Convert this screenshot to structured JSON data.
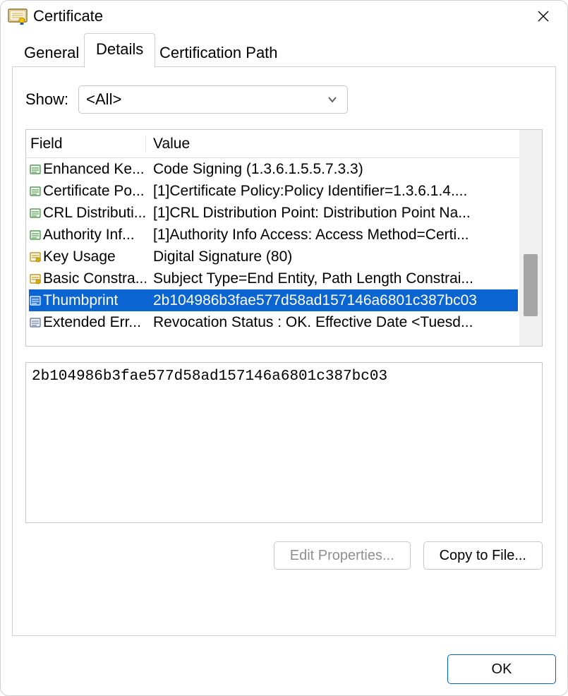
{
  "window": {
    "title": "Certificate"
  },
  "tabs": [
    {
      "label": "General",
      "active": false
    },
    {
      "label": "Details",
      "active": true
    },
    {
      "label": "Certification Path",
      "active": false
    }
  ],
  "show": {
    "label": "Show:",
    "value": "<All>"
  },
  "list": {
    "headers": {
      "field": "Field",
      "value": "Value"
    },
    "rows": [
      {
        "icon": "ext",
        "field": "Enhanced Ke...",
        "value": "Code Signing (1.3.6.1.5.5.7.3.3)",
        "selected": false
      },
      {
        "icon": "ext",
        "field": "Certificate Po...",
        "value": "[1]Certificate Policy:Policy Identifier=1.3.6.1.4....",
        "selected": false
      },
      {
        "icon": "ext",
        "field": "CRL Distributi...",
        "value": "[1]CRL Distribution Point: Distribution Point Na...",
        "selected": false
      },
      {
        "icon": "ext",
        "field": "Authority Inf...",
        "value": "[1]Authority Info Access: Access Method=Certi...",
        "selected": false
      },
      {
        "icon": "crit",
        "field": "Key Usage",
        "value": "Digital Signature (80)",
        "selected": false
      },
      {
        "icon": "crit",
        "field": "Basic Constra...",
        "value": "Subject Type=End Entity, Path Length Constrai...",
        "selected": false
      },
      {
        "icon": "prop",
        "field": "Thumbprint",
        "value": "2b104986b3fae577d58ad157146a6801c387bc03",
        "selected": true
      },
      {
        "icon": "prop",
        "field": "Extended Err...",
        "value": "Revocation Status : OK. Effective Date <Tuesd...",
        "selected": false
      }
    ]
  },
  "detail_value": "2b104986b3fae577d58ad157146a6801c387bc03",
  "buttons": {
    "edit": "Edit Properties...",
    "copy": "Copy to File...",
    "ok": "OK"
  }
}
